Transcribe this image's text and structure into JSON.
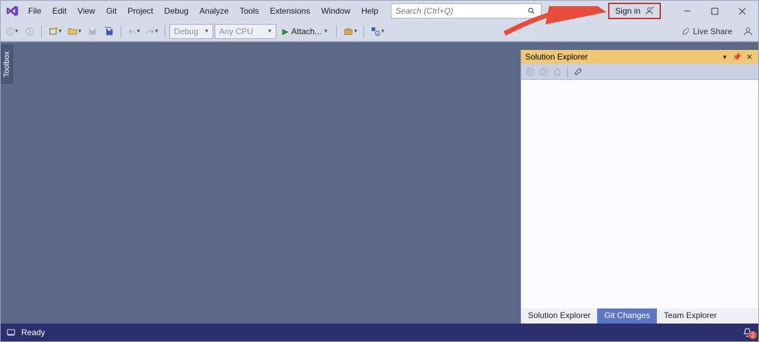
{
  "menu": {
    "items": [
      "File",
      "Edit",
      "View",
      "Git",
      "Project",
      "Debug",
      "Analyze",
      "Tools",
      "Extensions",
      "Window",
      "Help"
    ]
  },
  "search": {
    "placeholder": "Search (Ctrl+Q)"
  },
  "signin": {
    "label": "Sign in"
  },
  "toolbar": {
    "config": "Debug",
    "platform": "Any CPU",
    "attach": "Attach..."
  },
  "liveshare": {
    "label": "Live Share"
  },
  "toolbox": {
    "label": "Toolbox"
  },
  "solution": {
    "title": "Solution Explorer",
    "tabs": [
      "Solution Explorer",
      "Git Changes",
      "Team Explorer"
    ]
  },
  "status": {
    "ready": "Ready",
    "notifications": "2"
  }
}
